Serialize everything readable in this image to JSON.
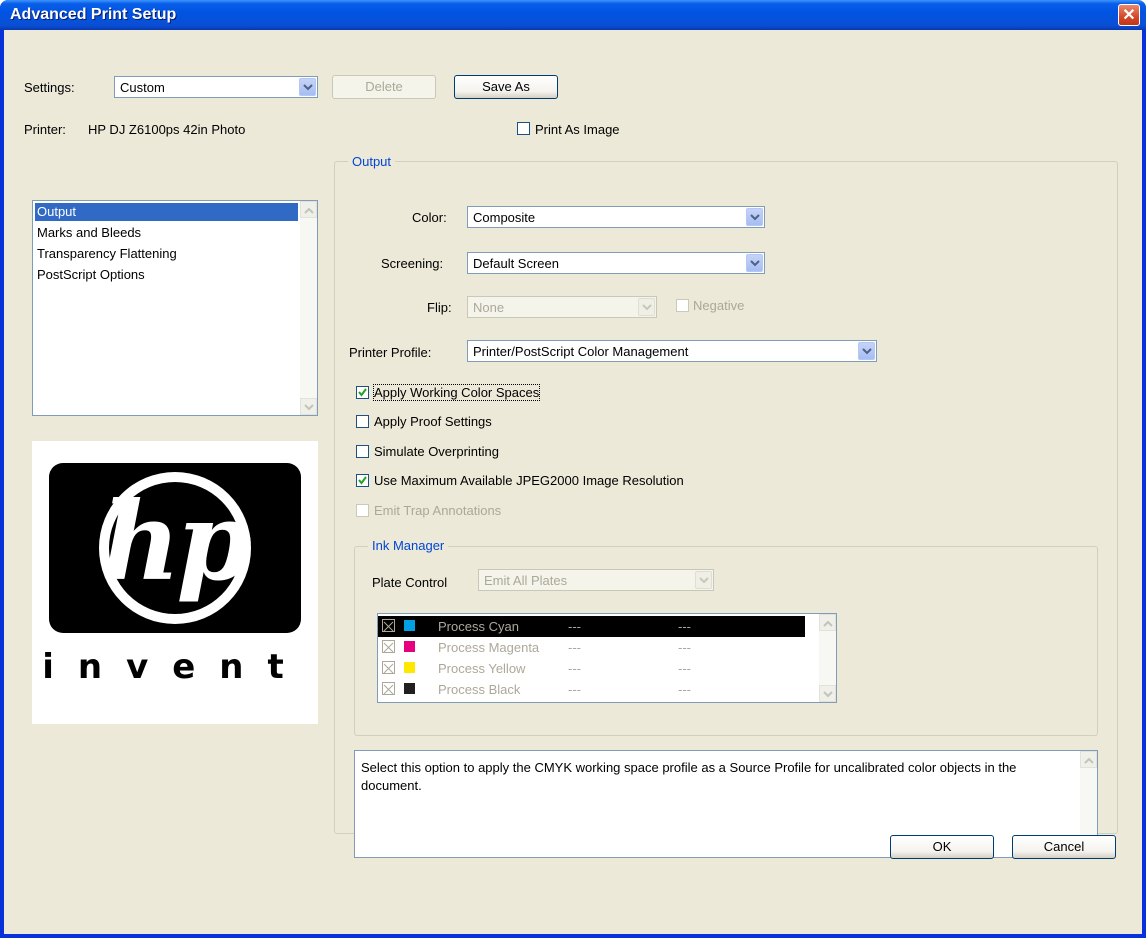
{
  "window": {
    "title": "Advanced Print Setup",
    "close_glyph": "✕"
  },
  "settings": {
    "label": "Settings:",
    "value": "Custom",
    "delete_label": "Delete",
    "save_as_label": "Save As"
  },
  "printer": {
    "label": "Printer:",
    "value": "HP DJ Z6100ps 42in Photo"
  },
  "print_as_image": {
    "label": "Print As Image",
    "checked": false
  },
  "categories": {
    "items": [
      "Output",
      "Marks and Bleeds",
      "Transparency Flattening",
      "PostScript Options"
    ],
    "selected": "Output"
  },
  "logo": {
    "brand": "hp",
    "tagline": "invent"
  },
  "output": {
    "group_title": "Output",
    "color_label": "Color:",
    "color_value": "Composite",
    "screening_label": "Screening:",
    "screening_value": "Default Screen",
    "flip_label": "Flip:",
    "flip_value": "None",
    "negative_label": "Negative",
    "printer_profile_label": "Printer Profile:",
    "printer_profile_value": "Printer/PostScript Color Management",
    "options": [
      {
        "label": "Apply Working Color Spaces",
        "checked": true,
        "enabled": true
      },
      {
        "label": "Apply Proof Settings",
        "checked": false,
        "enabled": true
      },
      {
        "label": "Simulate Overprinting",
        "checked": false,
        "enabled": true
      },
      {
        "label": "Use Maximum Available JPEG2000 Image Resolution",
        "checked": true,
        "enabled": true
      },
      {
        "label": "Emit Trap Annotations",
        "checked": false,
        "enabled": false
      }
    ]
  },
  "ink_manager": {
    "group_title": "Ink Manager",
    "plate_control_label": "Plate Control",
    "plate_control_value": "Emit All Plates",
    "inks": [
      {
        "name": "Process Cyan",
        "col1": "---",
        "col2": "---",
        "color": "#00a0e4",
        "selected": true
      },
      {
        "name": "Process Magenta",
        "col1": "---",
        "col2": "---",
        "color": "#e4007f",
        "selected": false
      },
      {
        "name": "Process Yellow",
        "col1": "---",
        "col2": "---",
        "color": "#ffe800",
        "selected": false
      },
      {
        "name": "Process Black",
        "col1": "---",
        "col2": "---",
        "color": "#231f20",
        "selected": false
      }
    ]
  },
  "description": "Select this option to apply the CMYK working space profile as a Source Profile for uncalibrated color objects in the document.",
  "buttons": {
    "ok": "OK",
    "cancel": "Cancel"
  }
}
